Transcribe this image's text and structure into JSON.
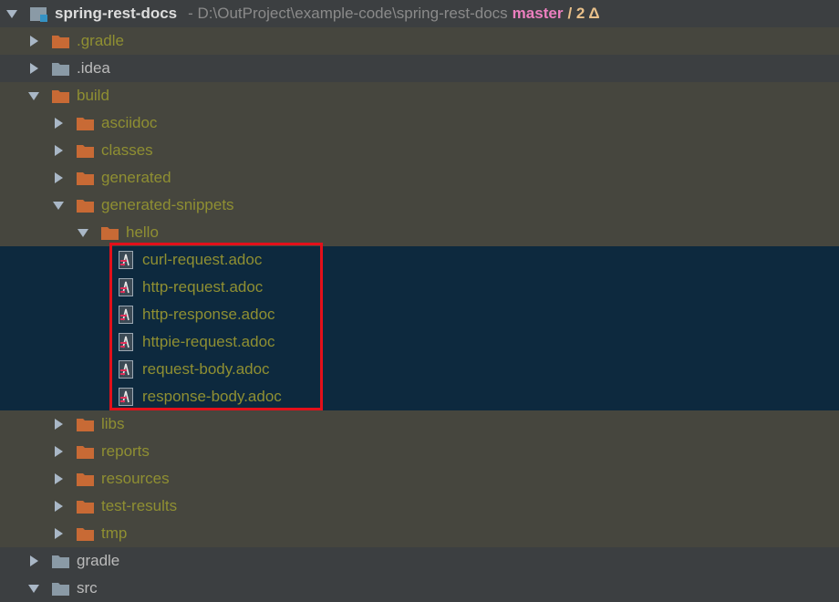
{
  "project": {
    "name": "spring-rest-docs",
    "path": "- D:\\OutProject\\example-code\\spring-rest-docs",
    "branch": "master",
    "changes": "/ 2 Δ"
  },
  "colors": {
    "folder_orange": "#c86a35",
    "folder_gray": "#8a9aa6",
    "ignored_text": "#8f8f32",
    "normal_text": "#bbbbbb",
    "selected_bg": "#0d293e",
    "highlight_border": "#e3101a"
  },
  "tree": [
    {
      "label": ".gradle",
      "type": "folder",
      "expanded": false,
      "ignored": true
    },
    {
      "label": ".idea",
      "type": "folder",
      "expanded": false,
      "ignored": false
    },
    {
      "label": "build",
      "type": "folder",
      "expanded": true,
      "ignored": true
    },
    {
      "label": "asciidoc",
      "type": "folder",
      "expanded": false,
      "ignored": true
    },
    {
      "label": "classes",
      "type": "folder",
      "expanded": false,
      "ignored": true
    },
    {
      "label": "generated",
      "type": "folder",
      "expanded": false,
      "ignored": true
    },
    {
      "label": "generated-snippets",
      "type": "folder",
      "expanded": true,
      "ignored": true
    },
    {
      "label": "hello",
      "type": "folder",
      "expanded": true,
      "ignored": true
    },
    {
      "label": "curl-request.adoc",
      "type": "file",
      "icon": "asciidoc-file-icon",
      "ignored": true,
      "selected": true
    },
    {
      "label": "http-request.adoc",
      "type": "file",
      "icon": "asciidoc-file-icon",
      "ignored": true,
      "selected": true
    },
    {
      "label": "http-response.adoc",
      "type": "file",
      "icon": "asciidoc-file-icon",
      "ignored": true,
      "selected": true
    },
    {
      "label": "httpie-request.adoc",
      "type": "file",
      "icon": "asciidoc-file-icon",
      "ignored": true,
      "selected": true
    },
    {
      "label": "request-body.adoc",
      "type": "file",
      "icon": "asciidoc-file-icon",
      "ignored": true,
      "selected": true
    },
    {
      "label": "response-body.adoc",
      "type": "file",
      "icon": "asciidoc-file-icon",
      "ignored": true,
      "selected": true
    },
    {
      "label": "libs",
      "type": "folder",
      "expanded": false,
      "ignored": true
    },
    {
      "label": "reports",
      "type": "folder",
      "expanded": false,
      "ignored": true
    },
    {
      "label": "resources",
      "type": "folder",
      "expanded": false,
      "ignored": true
    },
    {
      "label": "test-results",
      "type": "folder",
      "expanded": false,
      "ignored": true
    },
    {
      "label": "tmp",
      "type": "folder",
      "expanded": false,
      "ignored": true
    },
    {
      "label": "gradle",
      "type": "folder",
      "expanded": false,
      "ignored": false
    },
    {
      "label": "src",
      "type": "folder",
      "expanded": true,
      "ignored": false
    }
  ]
}
